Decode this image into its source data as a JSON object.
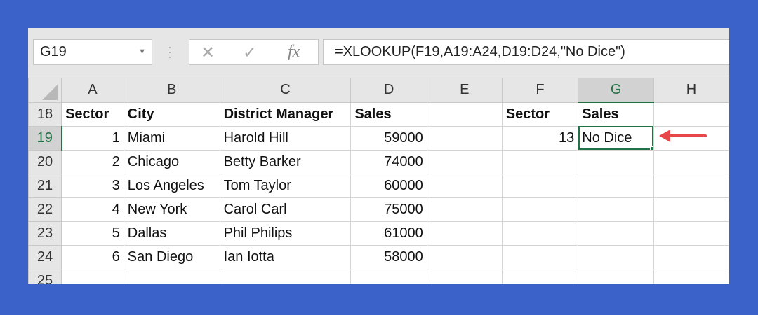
{
  "name_box": "G19",
  "formula_icons": [
    "cancel-icon",
    "enter-icon",
    "function-icon"
  ],
  "fx_label": "fx",
  "formula": "=XLOOKUP(F19,A19:A24,D19:D24,\"No Dice\")",
  "columns": [
    "A",
    "B",
    "C",
    "D",
    "E",
    "F",
    "G",
    "H"
  ],
  "rows": [
    {
      "n": "18",
      "cells": [
        "Sector",
        "City",
        "District Manager",
        "Sales",
        "",
        "Sector",
        "Sales",
        ""
      ]
    },
    {
      "n": "19",
      "cells": [
        "1",
        "Miami",
        "Harold Hill",
        "59000",
        "",
        "13",
        "No Dice",
        ""
      ]
    },
    {
      "n": "20",
      "cells": [
        "2",
        "Chicago",
        "Betty Barker",
        "74000",
        "",
        "",
        "",
        ""
      ]
    },
    {
      "n": "21",
      "cells": [
        "3",
        "Los Angeles",
        "Tom Taylor",
        "60000",
        "",
        "",
        "",
        ""
      ]
    },
    {
      "n": "22",
      "cells": [
        "4",
        "New York",
        "Carol Carl",
        "75000",
        "",
        "",
        "",
        ""
      ]
    },
    {
      "n": "23",
      "cells": [
        "5",
        "Dallas",
        "Phil Philips",
        "61000",
        "",
        "",
        "",
        ""
      ]
    },
    {
      "n": "24",
      "cells": [
        "6",
        "San Diego",
        "Ian Iotta",
        "58000",
        "",
        "",
        "",
        ""
      ]
    },
    {
      "n": "25",
      "cells": [
        "",
        "",
        "",
        "",
        "",
        "",
        "",
        ""
      ]
    }
  ],
  "colors": {
    "accent": "#217346",
    "arrow": "#e8474a",
    "background": "#3a62c9"
  }
}
